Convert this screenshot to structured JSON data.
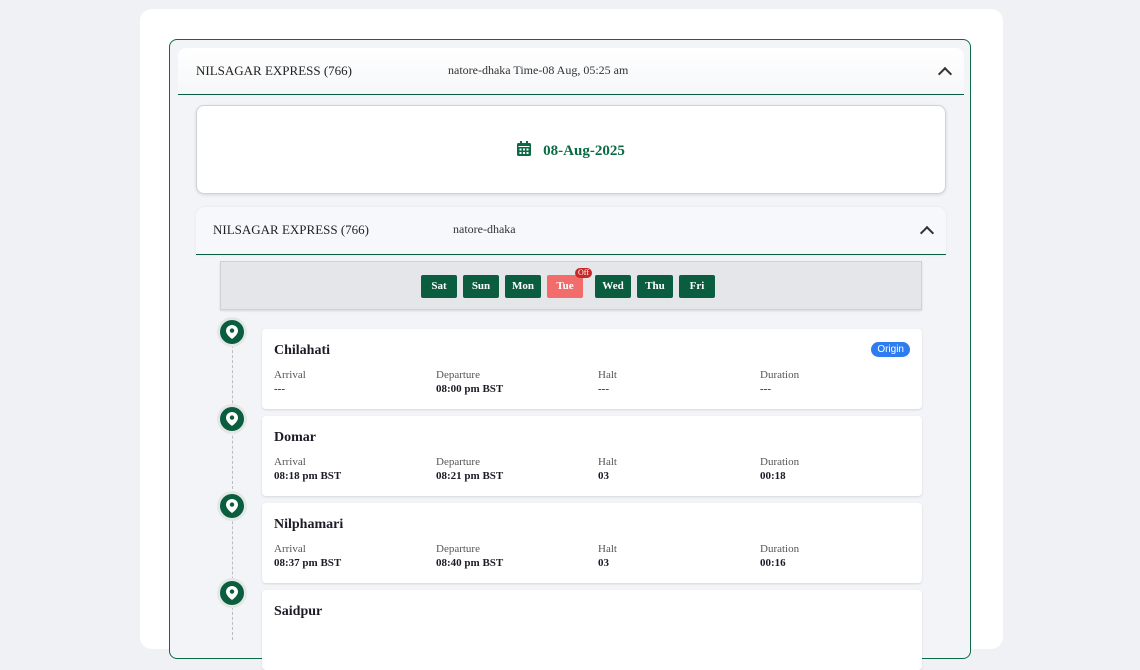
{
  "outer_header": {
    "train_name": "NILSAGAR EXPRESS (766)",
    "route_time": "natore-dhaka Time-08 Aug, 05:25 am"
  },
  "date_card": {
    "date": "08-Aug-2025"
  },
  "inner_header": {
    "train_name": "NILSAGAR EXPRESS (766)",
    "route": "natore-dhaka"
  },
  "days": [
    {
      "label": "Sat",
      "off": false
    },
    {
      "label": "Sun",
      "off": false
    },
    {
      "label": "Mon",
      "off": false
    },
    {
      "label": "Tue",
      "off": true,
      "badge": "Off"
    },
    {
      "label": "Wed",
      "off": false
    },
    {
      "label": "Thu",
      "off": false
    },
    {
      "label": "Fri",
      "off": false
    }
  ],
  "column_labels": {
    "arrival": "Arrival",
    "departure": "Departure",
    "halt": "Halt",
    "duration": "Duration"
  },
  "stations": [
    {
      "name": "Chilahati",
      "badge": "Origin",
      "arrival": "---",
      "departure": "08:00 pm BST",
      "halt": "---",
      "duration": "---"
    },
    {
      "name": "Domar",
      "arrival": "08:18 pm BST",
      "departure": "08:21 pm BST",
      "halt": "03",
      "duration": "00:18"
    },
    {
      "name": "Nilphamari",
      "arrival": "08:37 pm BST",
      "departure": "08:40 pm BST",
      "halt": "03",
      "duration": "00:16"
    },
    {
      "name": "Saidpur"
    }
  ],
  "colors": {
    "primary": "#0b5d3f",
    "off_day": "#f36c6c",
    "origin_badge": "#2f7bf0"
  }
}
